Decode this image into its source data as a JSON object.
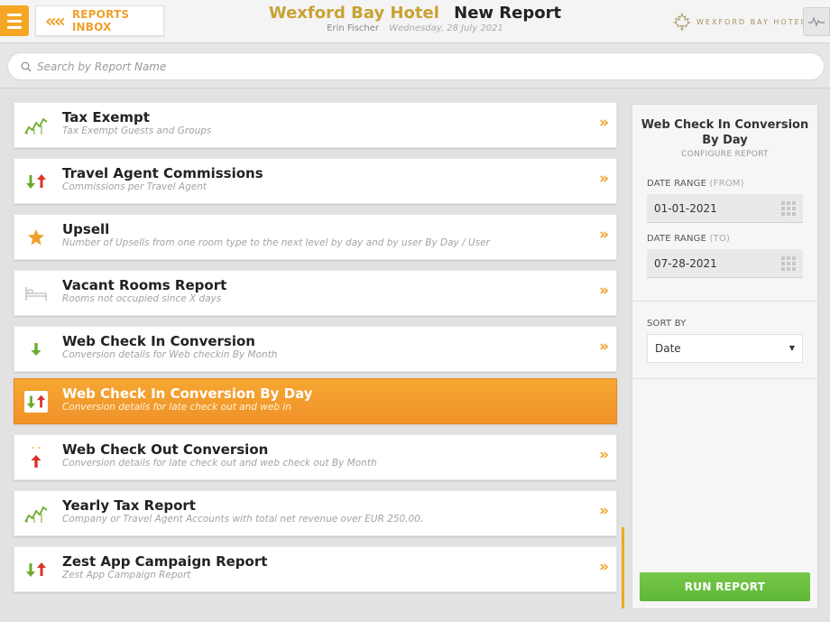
{
  "header": {
    "back_label": "REPORTS INBOX",
    "hotel_name": "Wexford Bay Hotel",
    "page_title": "New Report",
    "user_name": "Erin Fischer",
    "date": "Wednesday, 28 July 2021",
    "logo_text": "WEXFORD BAY HOTEL"
  },
  "search": {
    "placeholder": "Search by Report Name"
  },
  "reports": [
    {
      "name": "Tax Exempt",
      "desc": "Tax Exempt Guests and Groups",
      "icon": "trend-chart-icon"
    },
    {
      "name": "Travel Agent Commissions",
      "desc": "Commissions per Travel Agent",
      "icon": "up-down-arrows-icon"
    },
    {
      "name": "Upsell",
      "desc": "Number of Upsells from one room type to the next level by day and by user By Day / User",
      "icon": "star-icon"
    },
    {
      "name": "Vacant Rooms Report",
      "desc": "Rooms not occupied since X days",
      "icon": "bed-icon"
    },
    {
      "name": "Web Check In Conversion",
      "desc": "Conversion details for Web checkin By Month",
      "icon": "down-arrow-icon"
    },
    {
      "name": "Web Check In Conversion By Day",
      "desc": "Conversion details for late check out and web in",
      "icon": "up-down-arrows-icon",
      "active": true
    },
    {
      "name": "Web Check Out Conversion",
      "desc": "Conversion details for late check out and web check out By Month",
      "icon": "up-arrow-icon"
    },
    {
      "name": "Yearly Tax Report",
      "desc": "Company or Travel Agent Accounts with total net revenue over EUR 250.00.",
      "icon": "trend-chart-icon"
    },
    {
      "name": "Zest App Campaign Report",
      "desc": "Zest App Campaign Report",
      "icon": "up-down-arrows-icon"
    }
  ],
  "panel": {
    "title": "Web Check In Conversion By Day",
    "subtitle": "CONFIGURE REPORT",
    "date_from_label": "DATE RANGE",
    "date_from_hint": "(FROM)",
    "date_from_value": "01-01-2021",
    "date_to_label": "DATE RANGE",
    "date_to_hint": "(TO)",
    "date_to_value": "07-28-2021",
    "sort_label": "SORT BY",
    "sort_value": "Date",
    "run_label": "RUN REPORT"
  },
  "colors": {
    "accent": "#f5a623",
    "hotel_gold": "#c9a233",
    "run_green": "#6cc040",
    "arrow_red": "#d9342b",
    "arrow_green": "#6aab2e"
  }
}
